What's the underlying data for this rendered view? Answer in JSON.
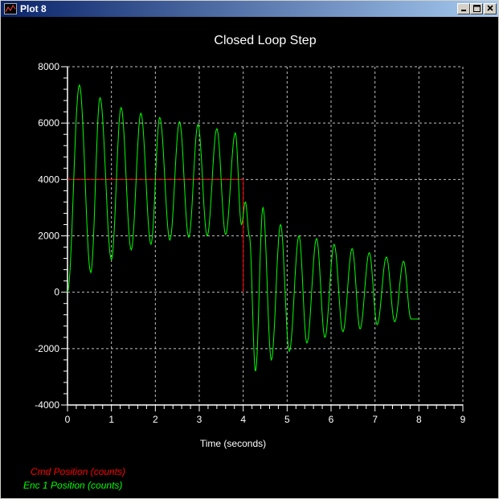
{
  "window": {
    "title": "Plot 8",
    "buttons": {
      "minimize": "_",
      "maximize": "□",
      "close": "×"
    }
  },
  "colors": {
    "background": "#000000",
    "grid": "#c0c0c0",
    "axis": "#ffffff",
    "text": "#ffffff",
    "cmd": "#ff0000",
    "enc": "#00ff00"
  },
  "chart_data": {
    "type": "line",
    "title": "Closed Loop Step",
    "xlabel": "Time (seconds)",
    "ylabel": "",
    "xlim": [
      0,
      9
    ],
    "ylim": [
      -4000,
      8000
    ],
    "xticks": [
      "0",
      "1",
      "2",
      "3",
      "4",
      "5",
      "6",
      "7",
      "8",
      "9"
    ],
    "yticks": [
      "8000",
      "6000",
      "4000",
      "2000",
      "0",
      "-2000",
      "-4000"
    ],
    "grid": true,
    "legend_position": "bottom-left",
    "series": [
      {
        "name": "Cmd Position (counts)",
        "color": "#ff0000",
        "x": [
          0,
          4,
          4,
          4
        ],
        "y": [
          4000,
          4000,
          4000,
          0
        ]
      },
      {
        "name": "Enc 1 Position (counts)",
        "color": "#00ff00",
        "x": [
          0,
          0.27,
          0.53,
          0.74,
          1.0,
          1.22,
          1.45,
          1.67,
          1.9,
          2.1,
          2.33,
          2.55,
          2.76,
          2.97,
          3.18,
          3.4,
          3.6,
          3.82,
          3.96,
          4.05,
          4.14,
          4.28,
          4.45,
          4.64,
          4.85,
          5.05,
          5.27,
          5.45,
          5.67,
          5.86,
          6.07,
          6.27,
          6.48,
          6.66,
          6.87,
          7.05,
          7.26,
          7.45,
          7.65,
          7.82,
          8.0
        ],
        "y": [
          0,
          7350,
          700,
          6900,
          1150,
          6550,
          1500,
          6350,
          1700,
          6200,
          1850,
          6050,
          1950,
          5950,
          2000,
          5800,
          2050,
          5650,
          2400,
          3200,
          2000,
          -2800,
          3000,
          -2400,
          2400,
          -2100,
          2000,
          -1800,
          1900,
          -1600,
          1700,
          -1400,
          1550,
          -1300,
          1400,
          -1150,
          1250,
          -1050,
          1100,
          -950,
          -950
        ]
      }
    ]
  }
}
